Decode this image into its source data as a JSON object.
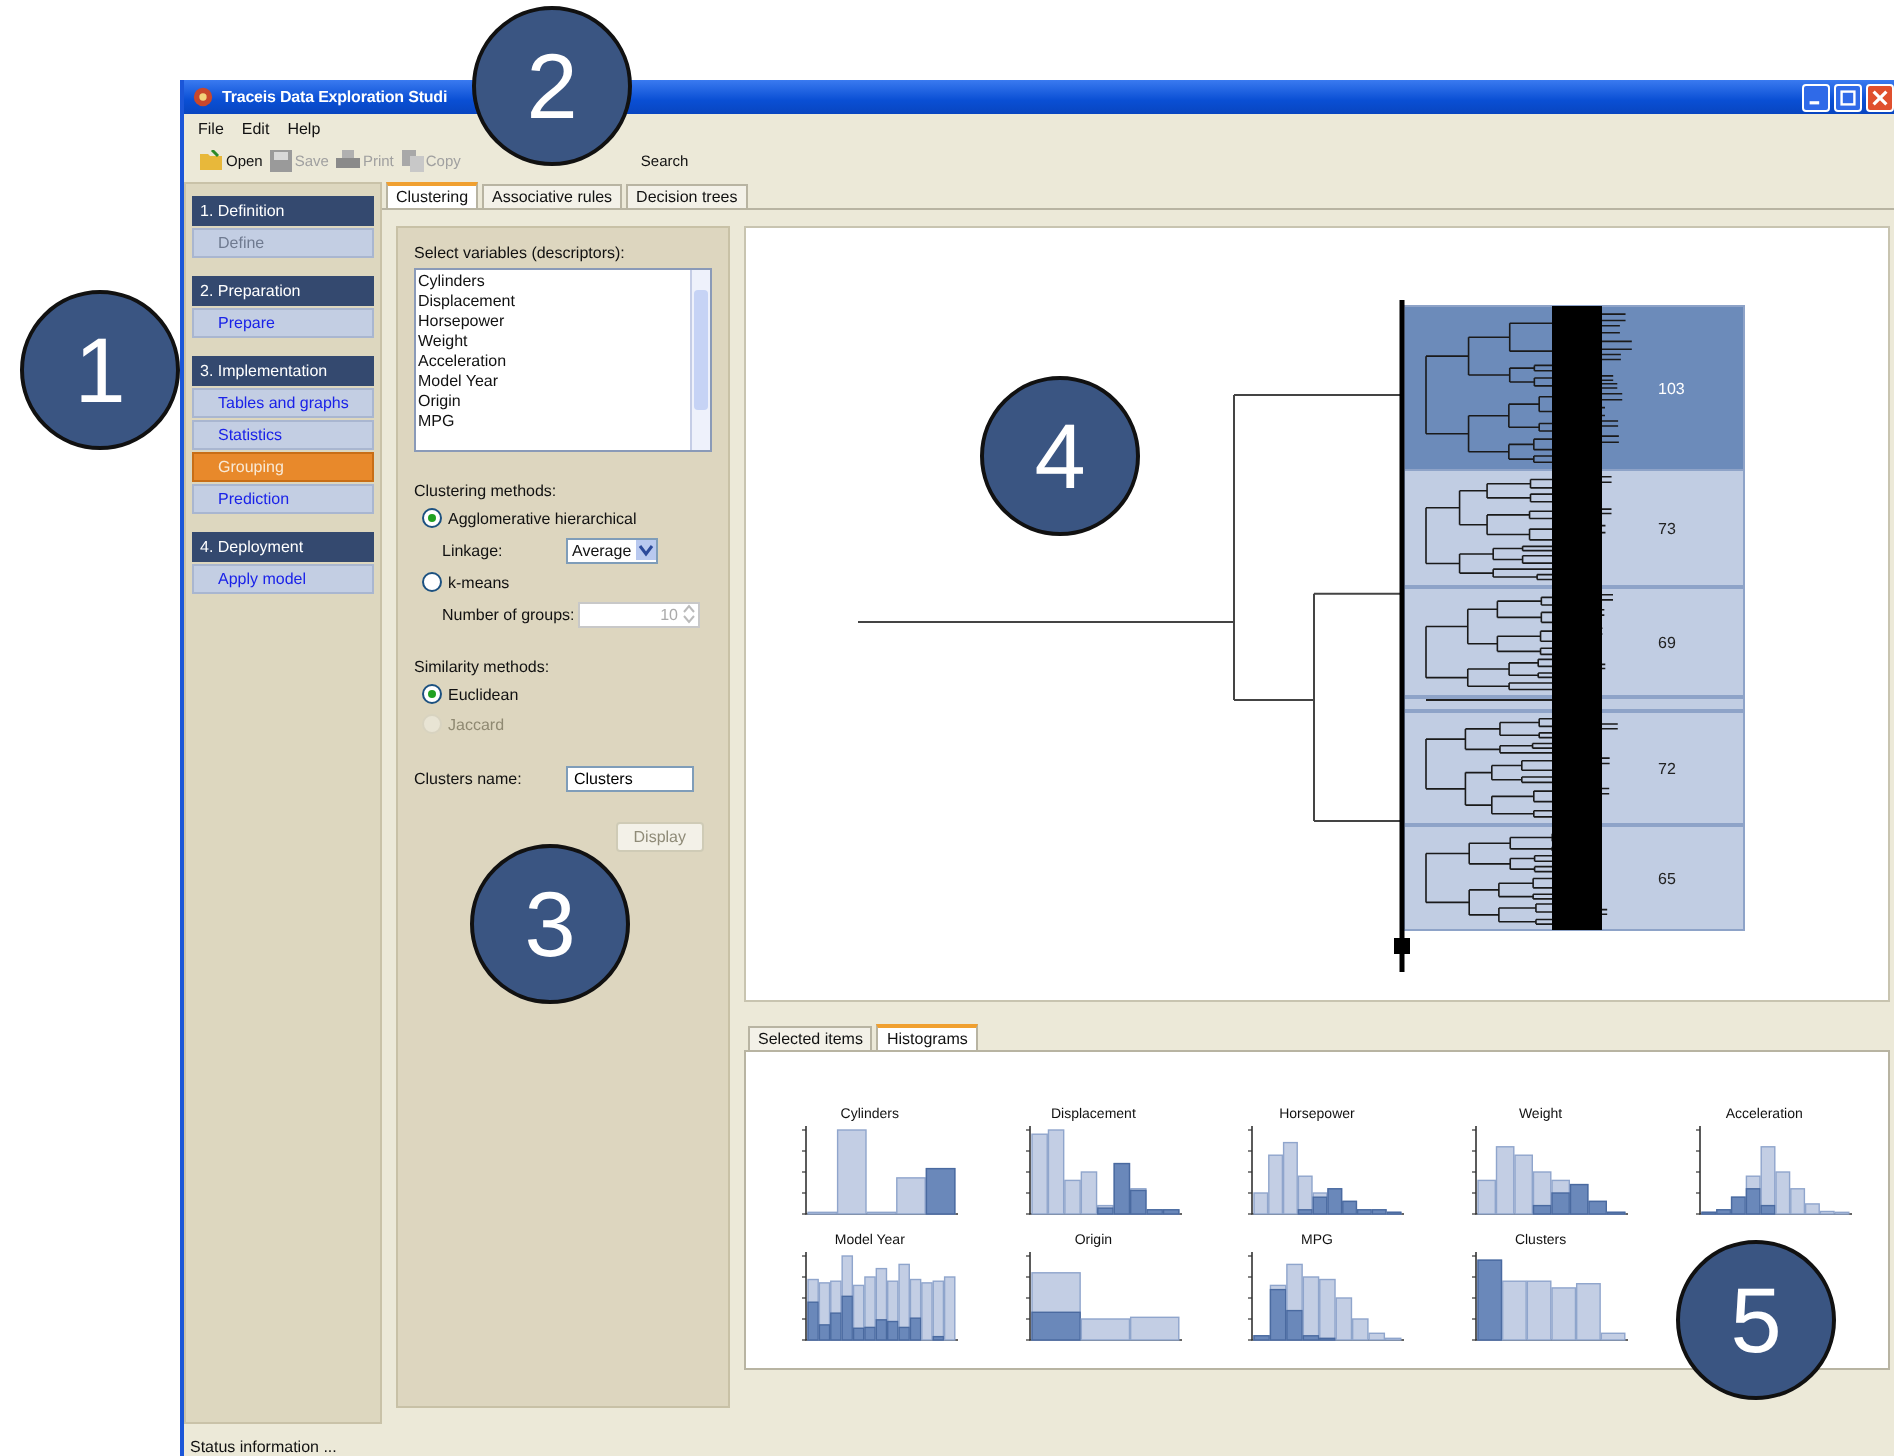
{
  "window": {
    "title": "Traceis Data Exploration Studi"
  },
  "menu": [
    "File",
    "Edit",
    "Help"
  ],
  "toolbar": [
    {
      "label": "Open",
      "disabled": false
    },
    {
      "label": "Save",
      "disabled": true
    },
    {
      "label": "Print",
      "disabled": true
    },
    {
      "label": "Copy",
      "disabled": true
    },
    {
      "label": "Search",
      "disabled": false
    }
  ],
  "sidebar": [
    {
      "title": "1. Definition",
      "items": [
        {
          "label": "Define",
          "disabled": true,
          "selected": false
        }
      ]
    },
    {
      "title": "2. Preparation",
      "items": [
        {
          "label": "Prepare",
          "disabled": false,
          "selected": false
        }
      ]
    },
    {
      "title": "3. Implementation",
      "items": [
        {
          "label": "Tables and graphs",
          "disabled": false,
          "selected": false
        },
        {
          "label": "Statistics",
          "disabled": false,
          "selected": false
        },
        {
          "label": "Grouping",
          "disabled": false,
          "selected": true
        },
        {
          "label": "Prediction",
          "disabled": false,
          "selected": false
        }
      ]
    },
    {
      "title": "4. Deployment",
      "items": [
        {
          "label": "Apply model",
          "disabled": false,
          "selected": false
        }
      ]
    }
  ],
  "tabs": [
    {
      "label": "Clustering",
      "selected": true
    },
    {
      "label": "Associative rules",
      "selected": false
    },
    {
      "label": "Decision trees",
      "selected": false
    }
  ],
  "settings": {
    "variables_label": "Select variables (descriptors):",
    "variables": [
      "Cylinders",
      "Displacement",
      "Horsepower",
      "Weight",
      "Acceleration",
      "Model Year",
      "Origin",
      "MPG"
    ],
    "methods_label": "Clustering methods:",
    "methods": [
      {
        "label": "Agglomerative hierarchical",
        "selected": true
      },
      {
        "label": "k-means",
        "selected": false
      }
    ],
    "linkage_label": "Linkage:",
    "linkage": "Average",
    "groups_label": "Number of groups:",
    "groups": "10",
    "similarity_label": "Similarity methods:",
    "similarity": [
      {
        "label": "Euclidean",
        "selected": true,
        "disabled": false
      },
      {
        "label": "Jaccard",
        "selected": false,
        "disabled": true
      }
    ],
    "name_label": "Clusters name:",
    "name": "Clusters",
    "display_button": {
      "label": "Display",
      "disabled": true
    }
  },
  "dendrogram": {
    "clusters": [
      {
        "count": "103",
        "selected": true
      },
      {
        "count": "73",
        "selected": false
      },
      {
        "count": "69",
        "selected": false
      },
      {
        "count": "72",
        "selected": false
      },
      {
        "count": "65",
        "selected": false
      }
    ]
  },
  "bottom_tabs": [
    {
      "label": "Selected items",
      "selected": false
    },
    {
      "label": "Histograms",
      "selected": true
    }
  ],
  "histograms": [
    {
      "title": "Cylinders"
    },
    {
      "title": "Displacement"
    },
    {
      "title": "Horsepower"
    },
    {
      "title": "Weight"
    },
    {
      "title": "Acceleration"
    },
    {
      "title": "Model Year"
    },
    {
      "title": "Origin"
    },
    {
      "title": "MPG"
    },
    {
      "title": "Clusters"
    }
  ],
  "status_bar": "Status information ...",
  "callouts": [
    "1",
    "2",
    "3",
    "4",
    "5"
  ]
}
